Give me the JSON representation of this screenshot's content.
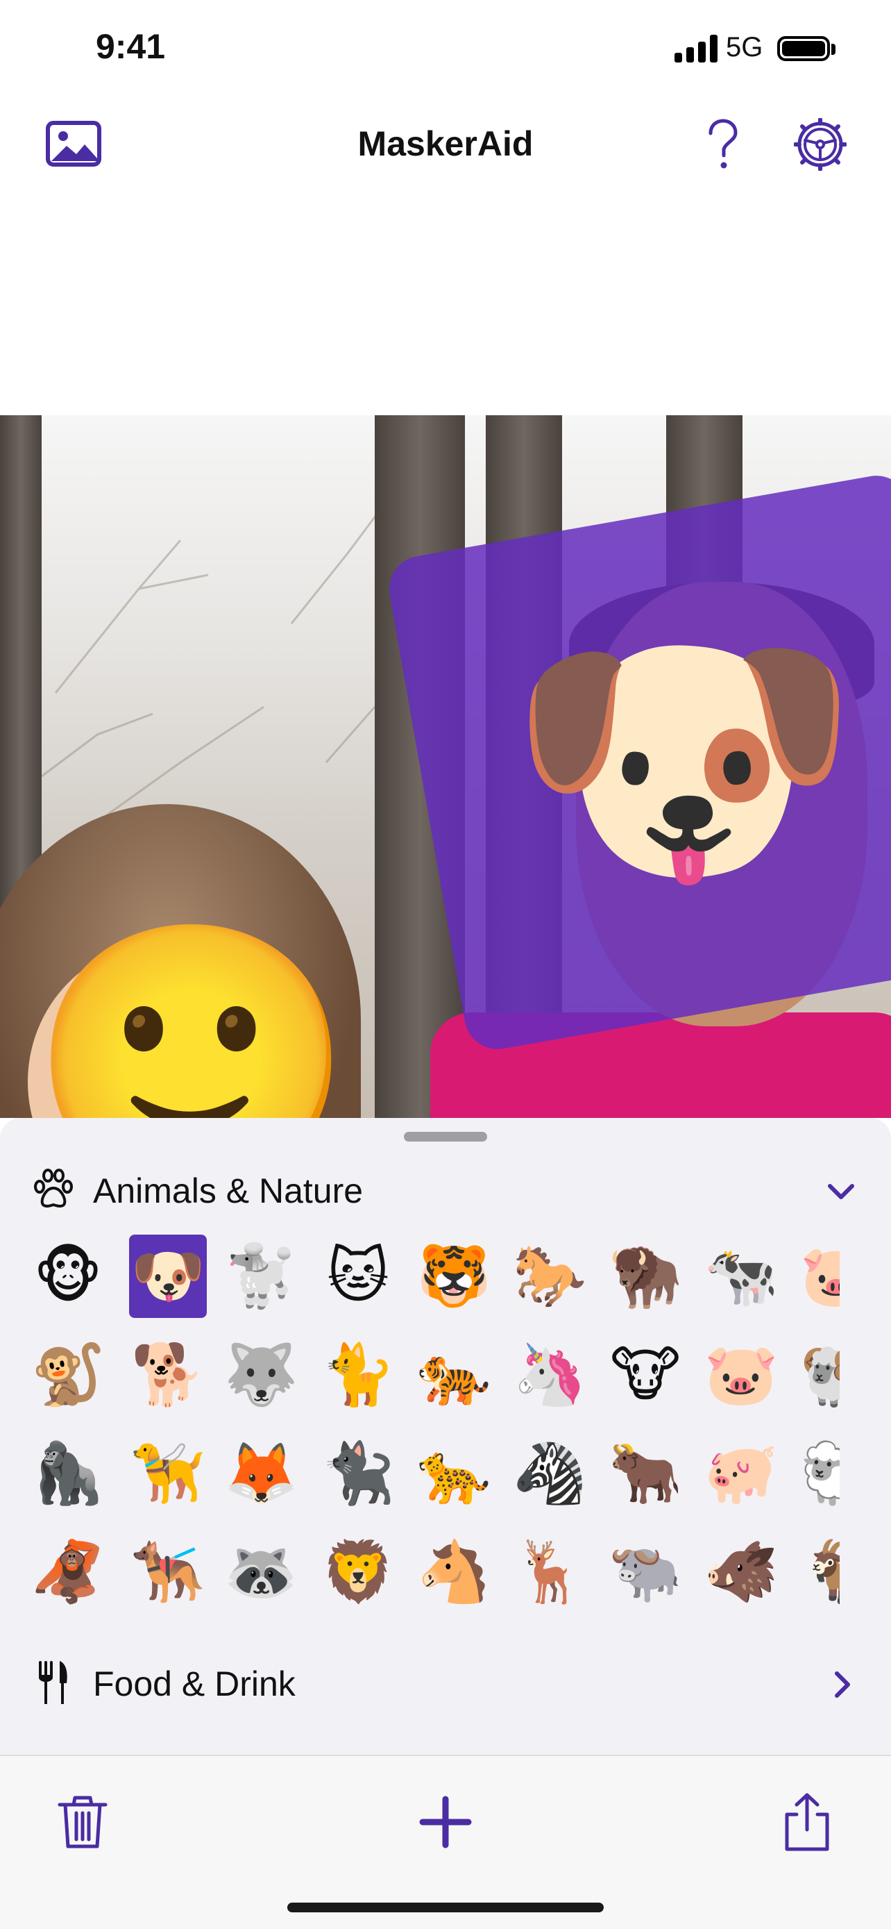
{
  "status_bar": {
    "time": "9:41",
    "network": "5G"
  },
  "nav": {
    "title": "MaskerAid"
  },
  "photo": {
    "masks": [
      {
        "emoji": "🐶"
      },
      {
        "emoji": "🙂"
      }
    ],
    "accent_color": "#652dbe"
  },
  "sheet": {
    "sections": [
      {
        "label": "Animals & Nature",
        "icon": "paw-icon",
        "expanded": true
      },
      {
        "label": "Food & Drink",
        "icon": "fork-knife-icon",
        "expanded": false
      }
    ],
    "emoji_rows": [
      [
        "🐵",
        "🐶",
        "🐩",
        "🐱",
        "🐯",
        "🐎",
        "🦬",
        "🐄",
        "🐷"
      ],
      [
        "🐒",
        "🐕",
        "🐺",
        "🐈",
        "🐅",
        "🦄",
        "🐮",
        "🐷",
        "🐏"
      ],
      [
        "🦍",
        "🦮",
        "🦊",
        "🐈‍⬛",
        "🐆",
        "🦓",
        "🐂",
        "🐖",
        "🐑"
      ],
      [
        "🦧",
        "🐕‍🦺",
        "🦝",
        "🦁",
        "🐴",
        "🦌",
        "🐃",
        "🐗",
        "🐐"
      ]
    ],
    "selected": "🐶"
  },
  "toolbar": {
    "delete": "trash-icon",
    "add": "plus-icon",
    "share": "share-icon"
  },
  "colors": {
    "accent": "#4a2ca3",
    "selected": "#5a34b4",
    "sheet_bg": "#f2f1f6"
  }
}
